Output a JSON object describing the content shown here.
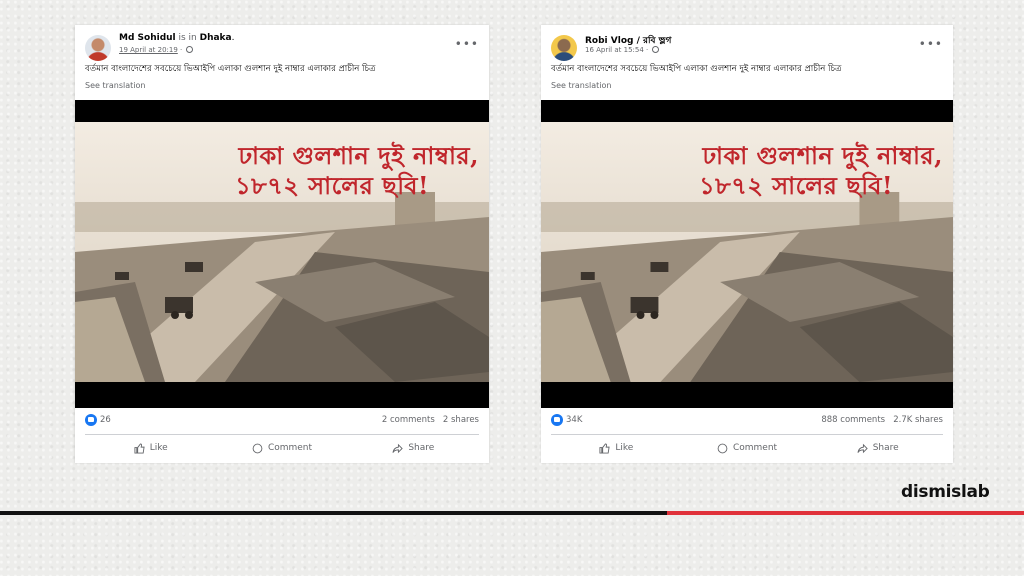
{
  "posts": [
    {
      "author": "Md Sohidul",
      "author_suffix": " is in ",
      "location": "Dhaka",
      "date": "19 April at 20:19",
      "caption": "বর্তমান বাংলাদেশের সবচেয়ে ভিআইপি এলাকা গুলশান দুই নাম্বার এলাকার প্রাচীন চিত্র",
      "see_translation": "See translation",
      "image_text_line1": "ঢাকা গুলশান দুই নাম্বার,",
      "image_text_line2": "১৮৭২ সালের ছবি!",
      "likes": "26",
      "comments": "2 comments",
      "shares": "2 shares",
      "like_label": "Like",
      "comment_label": "Comment",
      "share_label": "Share"
    },
    {
      "author": "Robi Vlog / রবি ভ্লগ",
      "author_suffix": "",
      "location": "",
      "date": "16 April at 15:54",
      "caption": "বর্তমান বাংলাদেশের সবচেয়ে ভিআইপি এলাকা গুলশান দুই নাম্বার এলাকার প্রাচীন চিত্র",
      "see_translation": "See translation",
      "image_text_line1": "ঢাকা গুলশান দুই নাম্বার,",
      "image_text_line2": "১৮৭২ সালের ছবি!",
      "likes": "34K",
      "comments": "888 comments",
      "shares": "2.7K shares",
      "like_label": "Like",
      "comment_label": "Comment",
      "share_label": "Share"
    }
  ],
  "brand": "dismislab",
  "colors": {
    "accent_red": "#e0313a",
    "facebook_blue": "#1877f2",
    "image_text": "#c0262c"
  },
  "icons": [
    "more-dots-icon",
    "globe-icon",
    "like-reaction-icon",
    "thumbs-up-icon",
    "comment-bubble-icon",
    "share-arrow-icon"
  ]
}
